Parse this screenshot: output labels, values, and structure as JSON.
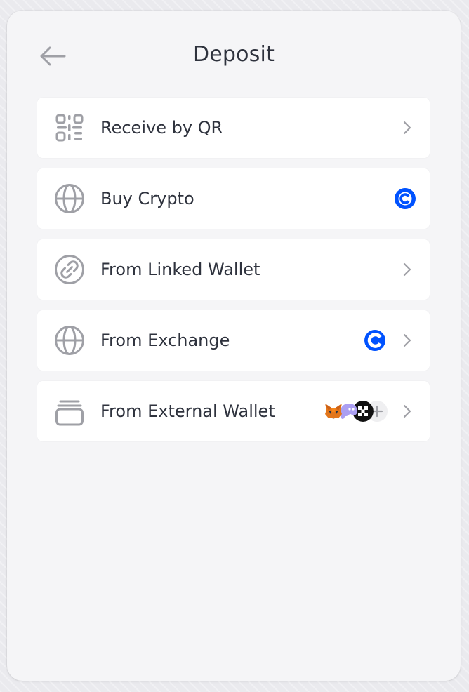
{
  "header": {
    "title": "Deposit"
  },
  "options": [
    {
      "label": "Receive by QR",
      "icon": "qr-code-icon"
    },
    {
      "label": "Buy Crypto",
      "icon": "globe-icon",
      "badge": "coinbase-icon"
    },
    {
      "label": "From Linked Wallet",
      "icon": "link-icon"
    },
    {
      "label": "From Exchange",
      "icon": "globe-icon",
      "badge": "coinbase-icon"
    },
    {
      "label": "From External Wallet",
      "icon": "wallet-icon",
      "badges": [
        "metamask-icon",
        "phantom-icon",
        "wallet-logo-icon",
        "plus-icon"
      ]
    }
  ],
  "colors": {
    "accent": "#0052ff",
    "text": "#2e323d",
    "icon": "#9fa0a6",
    "panel": "#f5f5f7",
    "card": "#ffffff"
  }
}
